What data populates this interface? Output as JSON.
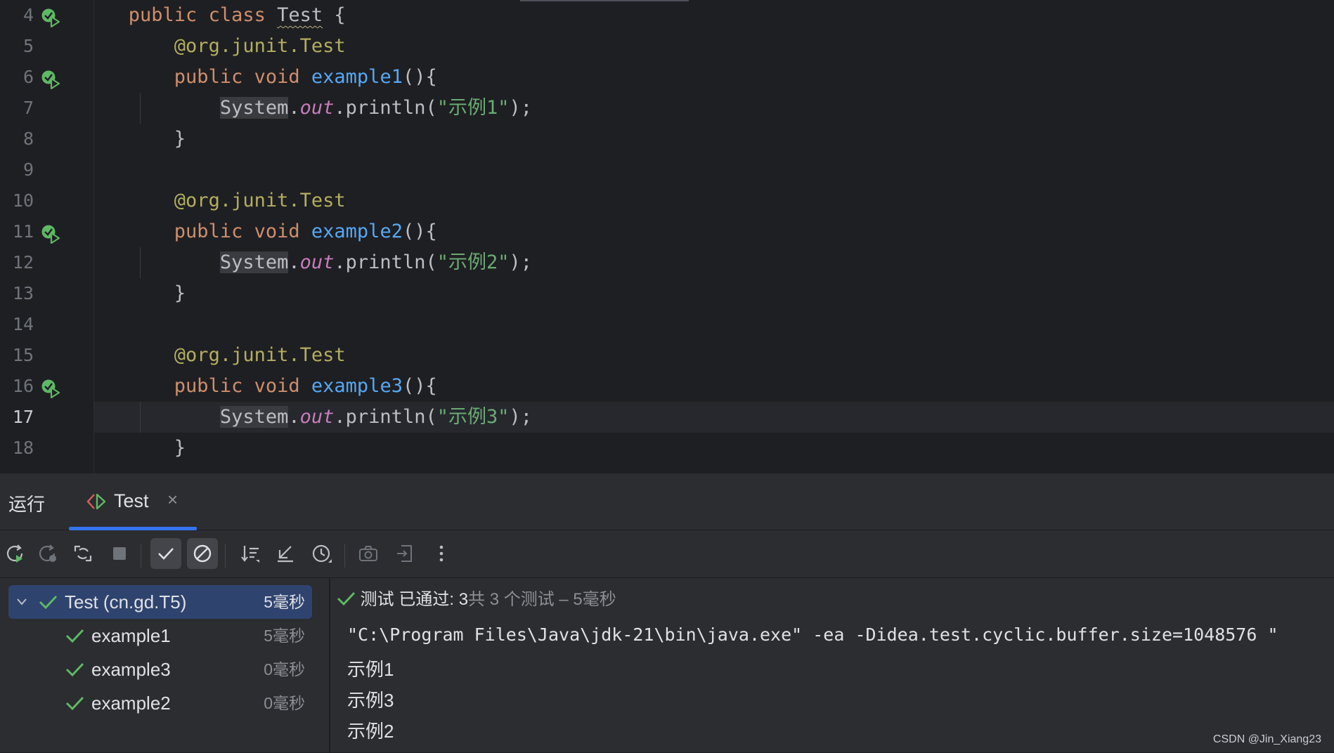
{
  "editor": {
    "lines": [
      {
        "num": "4",
        "gutter_icon": true
      },
      {
        "num": "5",
        "gutter_icon": false
      },
      {
        "num": "6",
        "gutter_icon": true
      },
      {
        "num": "7",
        "gutter_icon": false
      },
      {
        "num": "8",
        "gutter_icon": false
      },
      {
        "num": "9",
        "gutter_icon": false
      },
      {
        "num": "10",
        "gutter_icon": false
      },
      {
        "num": "11",
        "gutter_icon": true
      },
      {
        "num": "12",
        "gutter_icon": false
      },
      {
        "num": "13",
        "gutter_icon": false
      },
      {
        "num": "14",
        "gutter_icon": false
      },
      {
        "num": "15",
        "gutter_icon": false
      },
      {
        "num": "16",
        "gutter_icon": true
      },
      {
        "num": "17",
        "gutter_icon": false
      },
      {
        "num": "18",
        "gutter_icon": false
      }
    ],
    "current_line": "17",
    "code": {
      "kw_public": "public",
      "kw_class": "class",
      "class_name": "Test",
      "brace_open": " {",
      "brace_close": "}",
      "ann_at": "@org.junit.",
      "ann_name": "Test",
      "kw_void": "void",
      "method1": "example1",
      "method2": "example2",
      "method3": "example3",
      "paren_brace": "(){",
      "system": "System",
      "dot": ".",
      "out": "out",
      "println": ".println(",
      "str1": "\"示例1\"",
      "str2": "\"示例2\"",
      "str3": "\"示例3\"",
      "stmt_end": ");"
    }
  },
  "run_panel": {
    "title": "运行",
    "tab": {
      "label": "Test",
      "close": "×"
    },
    "toolbar": {
      "icons": [
        "rerun-icon",
        "rerun-failed-icon",
        "toggle-auto-test-icon",
        "stop-icon",
        "show-passed-icon",
        "show-ignored-icon",
        "sort-icon",
        "collapse-icon",
        "test-history-icon",
        "camera-icon",
        "export-icon",
        "more-options-icon"
      ]
    },
    "tree": {
      "root": {
        "label": "Test (cn.gd.T5)",
        "duration": "5毫秒"
      },
      "children": [
        {
          "label": "example1",
          "duration": "5毫秒"
        },
        {
          "label": "example3",
          "duration": "0毫秒"
        },
        {
          "label": "example2",
          "duration": "0毫秒"
        }
      ]
    },
    "console": {
      "status_label": "测试 已通过:",
      "status_count": "3",
      "status_rest": "共 3 个测试 – 5毫秒",
      "lines": [
        "\"C:\\Program Files\\Java\\jdk-21\\bin\\java.exe\" -ea -Didea.test.cyclic.buffer.size=1048576 \"",
        "示例1",
        "示例3",
        "示例2"
      ]
    },
    "watermark": "CSDN @Jin_Xiang23"
  },
  "colors": {
    "keyword": "#cf8e6d",
    "annotation": "#b3ae60",
    "method": "#56a8f5",
    "string": "#6aab73",
    "static_field": "#c77dbb",
    "pass_green": "#5fb865",
    "accent_blue": "#3574f0"
  }
}
